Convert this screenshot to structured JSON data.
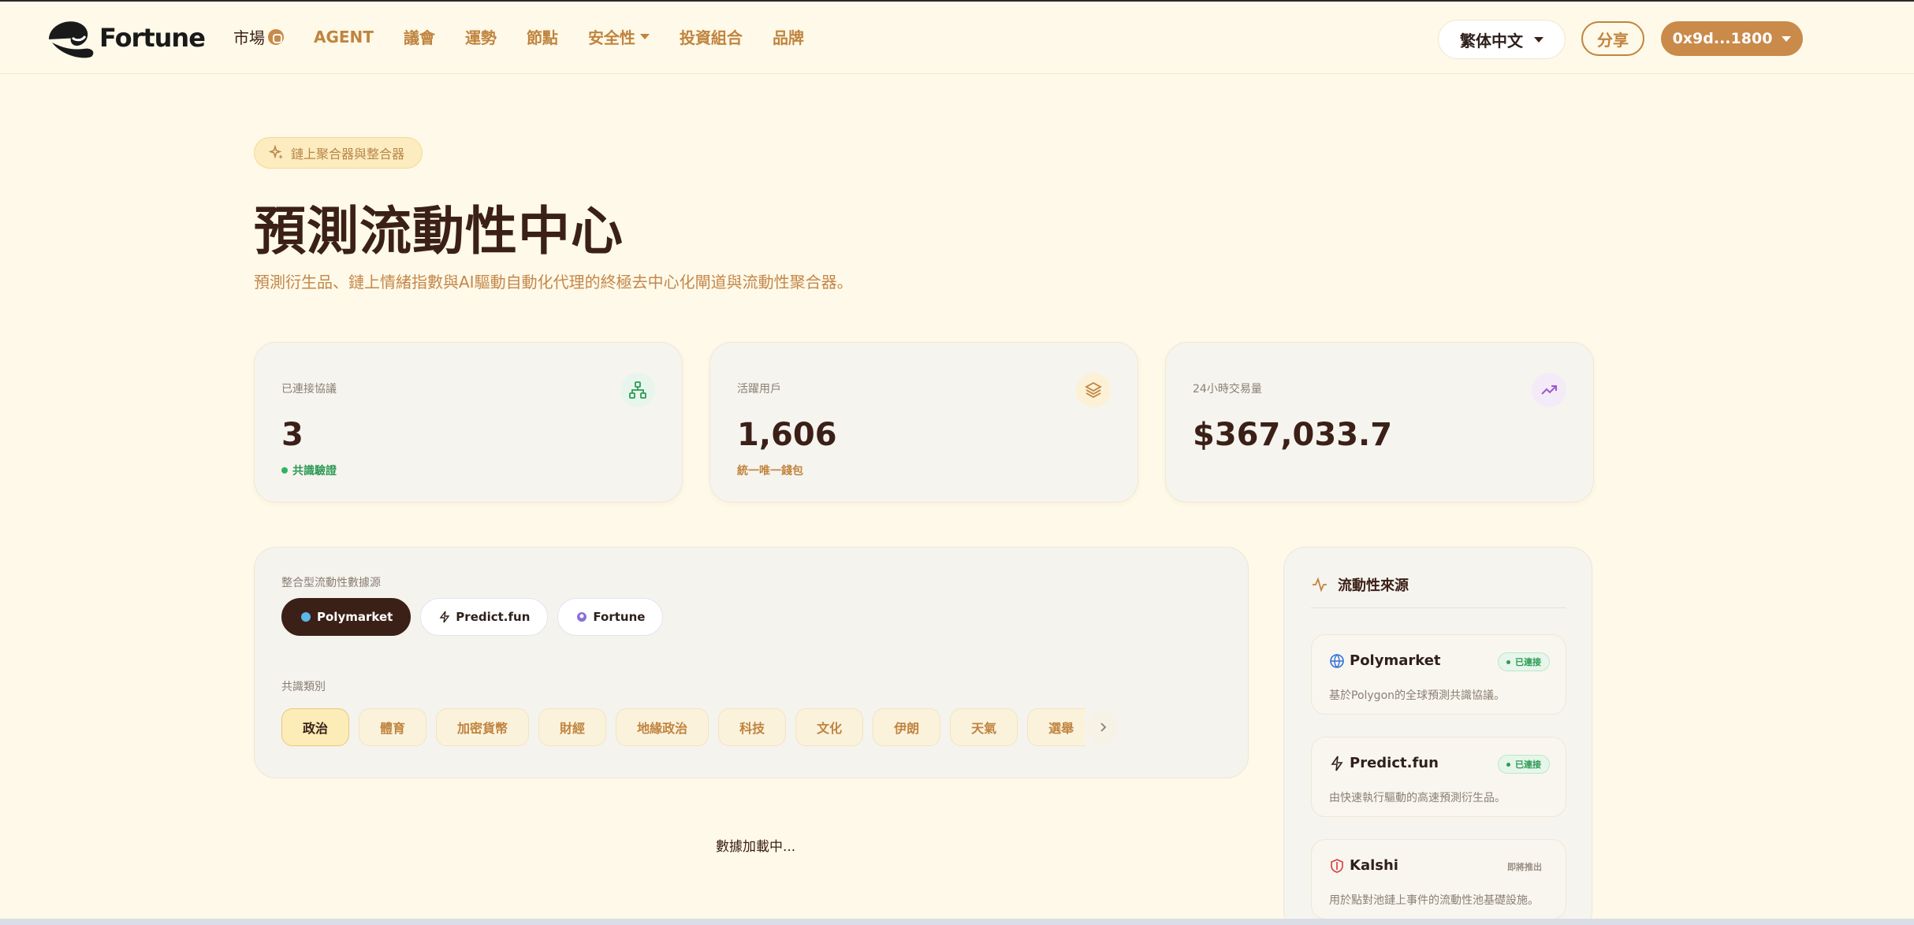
{
  "header": {
    "logo_text": "Fortune",
    "nav": [
      {
        "label": "市場"
      },
      {
        "label": "AGENT"
      },
      {
        "label": "議會"
      },
      {
        "label": "運勢"
      },
      {
        "label": "節點"
      },
      {
        "label": "安全性"
      },
      {
        "label": "投資組合"
      },
      {
        "label": "品牌"
      }
    ],
    "language": "繁体中文",
    "share": "分享",
    "wallet": "0x9d...1800"
  },
  "hero": {
    "pill": "鏈上聚合器與整合器",
    "title": "預測流動性中心",
    "subtitle": "預測衍生品、鏈上情緒指數與AI驅動自動化代理的終極去中心化閘道與流動性聚合器。"
  },
  "stats": [
    {
      "label": "已連接協議",
      "value": "3",
      "sub": "共識驗證",
      "icon": "network-icon",
      "color": "#2e9a55"
    },
    {
      "label": "活躍用戶",
      "value": "1,606",
      "sub": "統一唯一錢包",
      "icon": "layers-icon",
      "color": "#c0843f"
    },
    {
      "label": "24小時交易量",
      "value": "$367,033.7",
      "sub": "",
      "icon": "trending-up-icon",
      "color": "#9b59d0"
    }
  ],
  "filter": {
    "sources_label": "整合型流動性數據源",
    "sources": [
      "Polymarket",
      "Predict.fun",
      "Fortune"
    ],
    "categories_label": "共識類別",
    "categories": [
      "政治",
      "體育",
      "加密貨幣",
      "財經",
      "地緣政治",
      "科技",
      "文化",
      "伊朗",
      "天氣",
      "選舉"
    ]
  },
  "loading": "數據加載中...",
  "sidebar": {
    "title": "流動性來源",
    "sources": [
      {
        "name": "Polymarket",
        "status": "已連接",
        "desc": "基於Polygon的全球預測共識協議。"
      },
      {
        "name": "Predict.fun",
        "status": "已連接",
        "desc": "由快速執行驅動的高速預測衍生品。"
      },
      {
        "name": "Kalshi",
        "status": "即將推出",
        "desc": "用於點對池鏈上事件的流動性池基礎設施。"
      }
    ]
  }
}
